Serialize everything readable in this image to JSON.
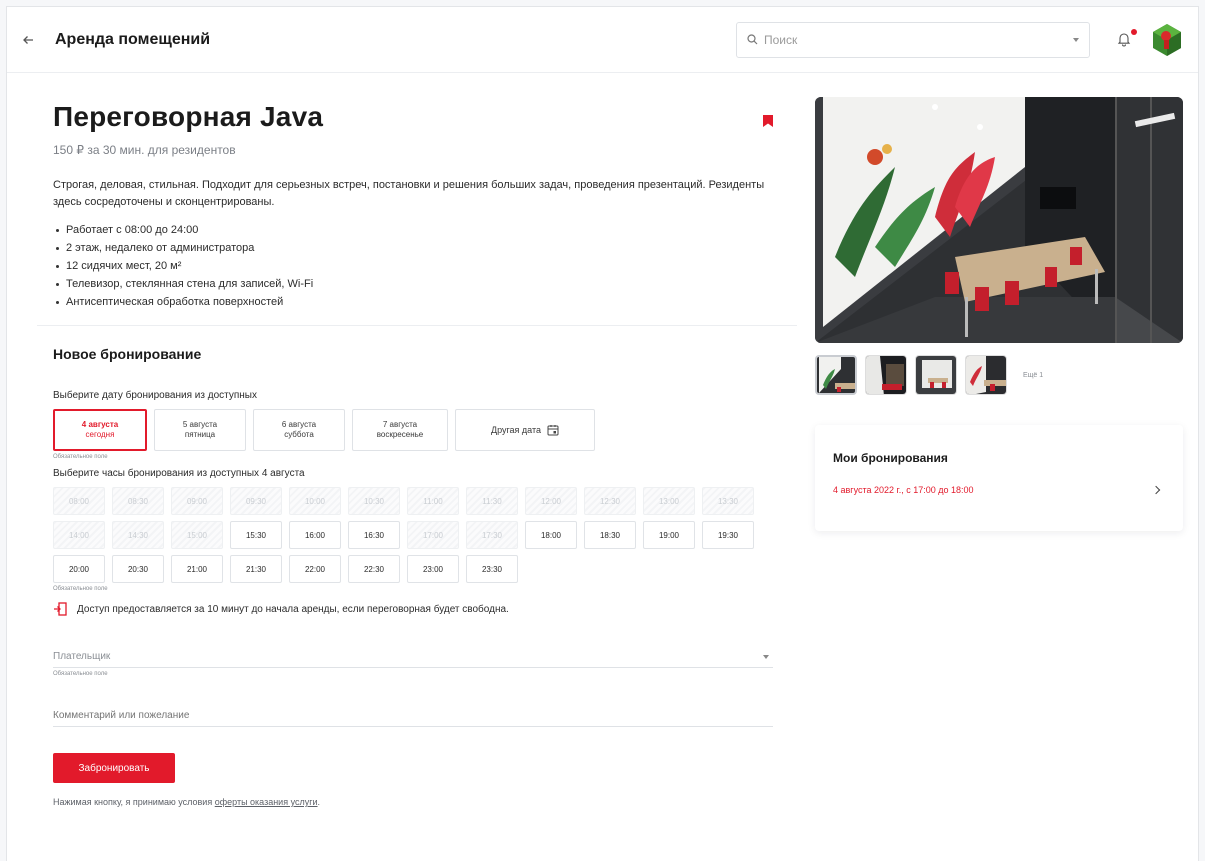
{
  "header": {
    "title": "Аренда помещений",
    "search_placeholder": "Поиск"
  },
  "room": {
    "title": "Переговорная Java",
    "price": "150 ₽ за 30 мин. для резидентов",
    "description": "Строгая, деловая, стильная. Подходит для серьезных встреч, постановки и решения больших задач, проведения презентаций. Резиденты здесь сосредоточены и сконцентрированы.",
    "features": [
      "Работает с 08:00 до 24:00",
      "2 этаж, недалеко от администратора",
      "12 сидячих мест, 20 м²",
      "Телевизор, стеклянная стена для записей, Wi-Fi",
      "Антисептическая обработка поверхностей"
    ]
  },
  "booking": {
    "title": "Новое бронирование",
    "date_label": "Выберите дату бронирования из доступных",
    "dates": [
      {
        "day": "4 августа",
        "weekday": "сегодня"
      },
      {
        "day": "5 августа",
        "weekday": "пятница"
      },
      {
        "day": "6 августа",
        "weekday": "суббота"
      },
      {
        "day": "7 августа",
        "weekday": "воскресенье"
      }
    ],
    "other_date": "Другая дата",
    "required": "Обязательное поле",
    "time_label": "Выберите часы бронирования из доступных 4 августа",
    "slots": [
      {
        "t": "08:00",
        "disabled": true
      },
      {
        "t": "08:30",
        "disabled": true
      },
      {
        "t": "09:00",
        "disabled": true
      },
      {
        "t": "09:30",
        "disabled": true
      },
      {
        "t": "10:00",
        "disabled": true
      },
      {
        "t": "10:30",
        "disabled": true
      },
      {
        "t": "11:00",
        "disabled": true
      },
      {
        "t": "11:30",
        "disabled": true
      },
      {
        "t": "12:00",
        "disabled": true
      },
      {
        "t": "12:30",
        "disabled": true
      },
      {
        "t": "13:00",
        "disabled": true
      },
      {
        "t": "13:30",
        "disabled": true
      },
      {
        "t": "14:00",
        "disabled": true
      },
      {
        "t": "14:30",
        "disabled": true
      },
      {
        "t": "15:00",
        "disabled": true
      },
      {
        "t": "15:30",
        "disabled": false
      },
      {
        "t": "16:00",
        "disabled": false
      },
      {
        "t": "16:30",
        "disabled": false
      },
      {
        "t": "17:00",
        "disabled": true
      },
      {
        "t": "17:30",
        "disabled": true
      },
      {
        "t": "18:00",
        "disabled": false
      },
      {
        "t": "18:30",
        "disabled": false
      },
      {
        "t": "19:00",
        "disabled": false
      },
      {
        "t": "19:30",
        "disabled": false
      },
      {
        "t": "20:00",
        "disabled": false
      },
      {
        "t": "20:30",
        "disabled": false
      },
      {
        "t": "21:00",
        "disabled": false
      },
      {
        "t": "21:30",
        "disabled": false
      },
      {
        "t": "22:00",
        "disabled": false
      },
      {
        "t": "22:30",
        "disabled": false
      },
      {
        "t": "23:00",
        "disabled": false
      },
      {
        "t": "23:30",
        "disabled": false
      }
    ],
    "access_note": "Доступ предоставляется за 10 минут до начала аренды, если переговорная будет свободна.",
    "payer_placeholder": "Плательщик",
    "comment_placeholder": "Комментарий или пожелание",
    "submit_label": "Забронировать",
    "terms_prefix": "Нажимая кнопку, я принимаю условия ",
    "terms_link": "оферты оказания услуги",
    "terms_suffix": "."
  },
  "gallery": {
    "more_label": "Ещё 1"
  },
  "my_bookings": {
    "title": "Мои бронирования",
    "items": [
      "4 августа 2022 г., с 17:00 до 18:00"
    ]
  },
  "colors": {
    "accent": "#e21a2b",
    "text": "#1b1b1b",
    "muted": "#8a8e94",
    "border": "#dfe2e6"
  }
}
